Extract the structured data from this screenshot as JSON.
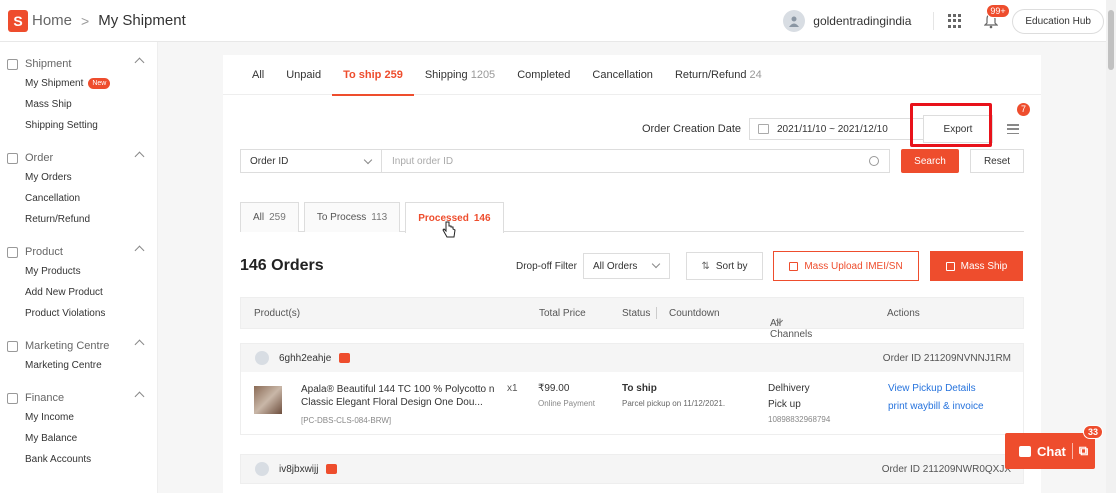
{
  "topbar": {
    "home": "Home",
    "separator": ">",
    "page": "My Shipment",
    "username": "goldentradingindia",
    "notif_count": "99+",
    "education": "Education Hub"
  },
  "sidebar": {
    "sections": [
      {
        "title": "Shipment",
        "items": [
          "My Shipment",
          "Mass Ship",
          "Shipping Setting"
        ],
        "badge": "New"
      },
      {
        "title": "Order",
        "items": [
          "My Orders",
          "Cancellation",
          "Return/Refund"
        ]
      },
      {
        "title": "Product",
        "items": [
          "My Products",
          "Add New Product",
          "Product Violations"
        ]
      },
      {
        "title": "Marketing Centre",
        "items": [
          "Marketing Centre"
        ]
      },
      {
        "title": "Finance",
        "items": [
          "My Income",
          "My Balance",
          "Bank Accounts"
        ]
      }
    ]
  },
  "tabs": [
    {
      "label": "All",
      "count": ""
    },
    {
      "label": "Unpaid",
      "count": ""
    },
    {
      "label": "To ship",
      "count": "259"
    },
    {
      "label": "Shipping",
      "count": "1205"
    },
    {
      "label": "Completed",
      "count": ""
    },
    {
      "label": "Cancellation",
      "count": ""
    },
    {
      "label": "Return/Refund",
      "count": "24"
    }
  ],
  "filters": {
    "date_label": "Order Creation Date",
    "date_range": "2021/11/10 ~ 2021/12/10",
    "export": "Export",
    "menu_badge": "7",
    "search_field": "Order ID",
    "search_placeholder": "Input order ID",
    "search_btn": "Search",
    "reset_btn": "Reset"
  },
  "subtabs": [
    {
      "label": "All",
      "count": "259"
    },
    {
      "label": "To Process",
      "count": "113"
    },
    {
      "label": "Processed",
      "count": "146"
    }
  ],
  "orders_bar": {
    "title": "146 Orders",
    "dropoff_label": "Drop-off Filter",
    "dropoff_value": "All Orders",
    "sort": "Sort by",
    "mass_upload": "Mass Upload IMEI/SN",
    "mass_ship": "Mass Ship"
  },
  "table_header": {
    "product": "Product(s)",
    "total": "Total Price",
    "status": "Status",
    "countdown": "Countdown",
    "channels": "All Channels",
    "actions": "Actions"
  },
  "orders": [
    {
      "buyer": "6ghh2eahje",
      "order_id": "Order ID 211209NVNNJ1RM",
      "product": "Apala® Beautiful 144 TC 100 % Polycotto n Classic Elegant Floral Design One Dou...",
      "sku": "[PC-DBS-CLS-084-BRW]",
      "qty": "x1",
      "price": "₹99.00",
      "payment": "Online Payment",
      "status": "To ship",
      "status_sub": "Parcel pickup on 11/12/2021.",
      "carrier": "Delhivery",
      "pickup": "Pick up",
      "tracking": "10898832968794",
      "action1": "View Pickup Details",
      "action2": "print waybill & invoice"
    },
    {
      "buyer": "iv8jbxwijj",
      "order_id": "Order ID 211209NWR0QXJX"
    }
  ],
  "chat": {
    "label": "Chat",
    "badge": "33"
  },
  "colors": {
    "accent": "#ee4d2d",
    "highlight": "#e8121a",
    "link": "#2673dd"
  }
}
